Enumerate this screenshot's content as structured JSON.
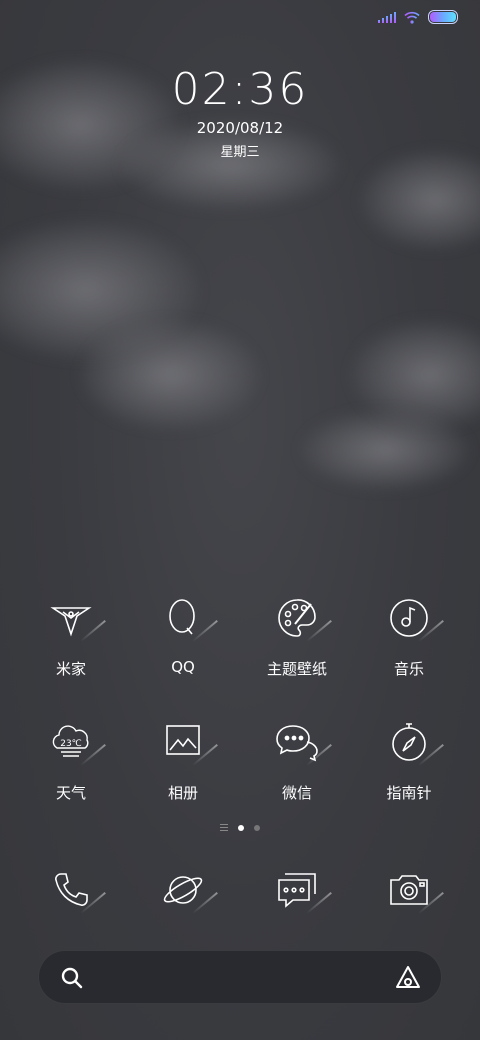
{
  "status_bar": {
    "signal_icon": "signal-icon",
    "wifi_icon": "wifi-icon",
    "battery_icon": "battery-icon",
    "battery_level": 1.0,
    "accent_colors": [
      "#b25cff",
      "#6aa8ff",
      "#5ee0ff"
    ]
  },
  "lockscreen": {
    "time": "02:36",
    "date": "2020/08/12",
    "weekday": "星期三"
  },
  "apps": [
    {
      "label": "米家",
      "icon": "mijia-icon"
    },
    {
      "label": "QQ",
      "icon": "qq-icon"
    },
    {
      "label": "主题壁纸",
      "icon": "palette-icon"
    },
    {
      "label": "音乐",
      "icon": "music-icon"
    },
    {
      "label": "天气",
      "icon": "weather-icon",
      "icon_text": "23℃"
    },
    {
      "label": "相册",
      "icon": "gallery-icon"
    },
    {
      "label": "微信",
      "icon": "wechat-icon"
    },
    {
      "label": "指南针",
      "icon": "compass-icon"
    }
  ],
  "pager": {
    "pages": 2,
    "active": 0
  },
  "dock": [
    {
      "icon": "phone-icon"
    },
    {
      "icon": "browser-planet-icon"
    },
    {
      "icon": "messages-icon"
    },
    {
      "icon": "camera-icon"
    }
  ],
  "search_bar": {
    "search_icon": "search-icon",
    "assistant_icon": "assistant-icon"
  }
}
